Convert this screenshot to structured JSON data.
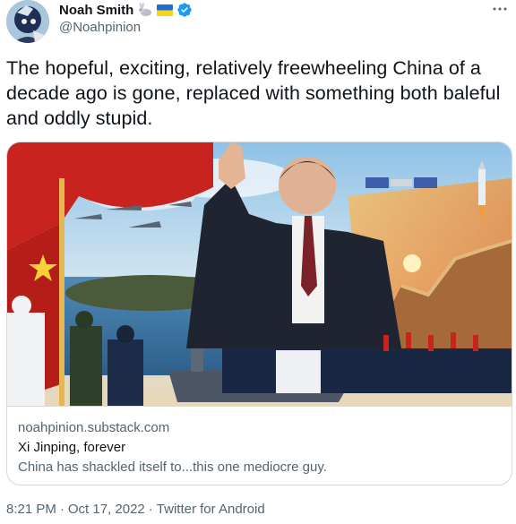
{
  "author": {
    "display_name": "Noah Smith",
    "badge_icons": [
      "rabbit-emoji",
      "ukraine-flag-emoji",
      "verified-badge-icon"
    ],
    "handle": "@Noahpinion"
  },
  "tweet": {
    "text": "The hopeful, exciting, relatively freewheeling China of a decade ago is gone, replaced with something both baleful and oddly stupid."
  },
  "card": {
    "domain": "noahpinion.substack.com",
    "title": "Xi Jinping, forever",
    "description": "China has shackled itself to...this one mediocre guy."
  },
  "meta": {
    "time": "8:21 PM",
    "separator": "·",
    "date": "Oct 17, 2022",
    "source": "Twitter for Android"
  },
  "colors": {
    "text_primary": "#0f1419",
    "text_secondary": "#536471",
    "border": "#cfd9de",
    "verified_blue": "#1d9bf0"
  }
}
